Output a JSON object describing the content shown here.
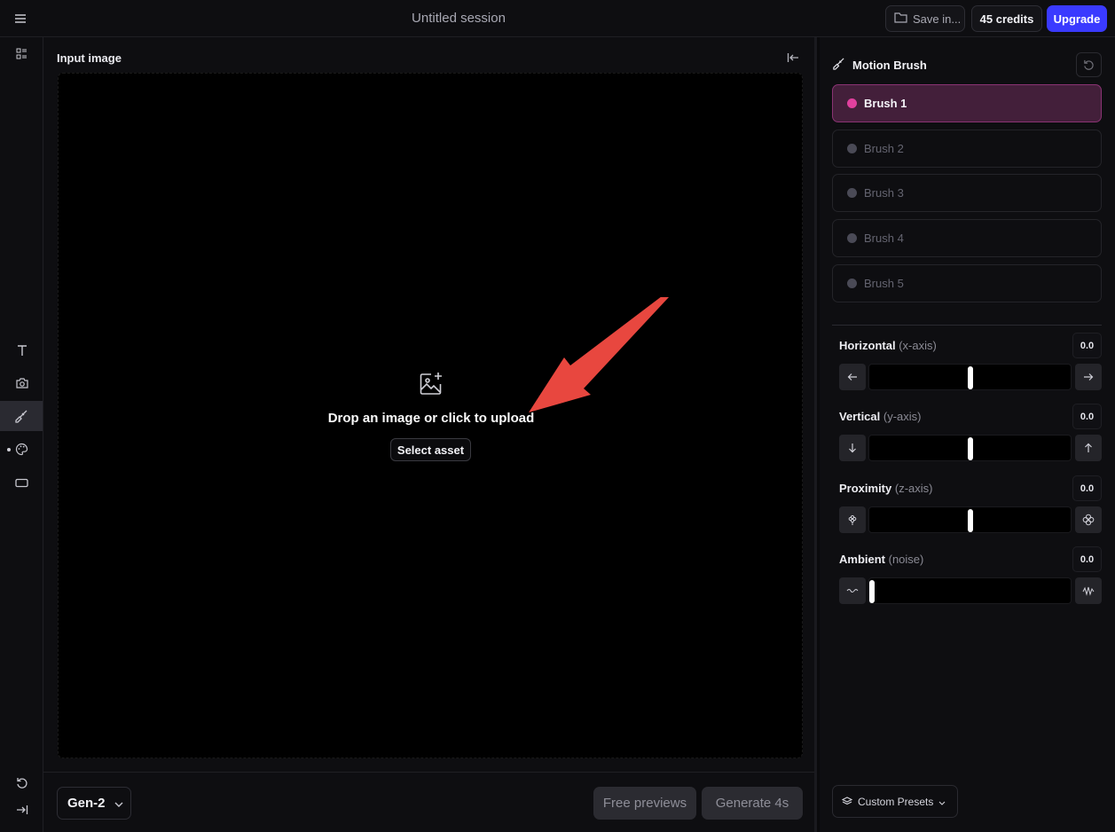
{
  "header": {
    "title": "Untitled session",
    "save_label": "Save in...",
    "credits_label": "45 credits",
    "upgrade_label": "Upgrade"
  },
  "main": {
    "input_label": "Input image",
    "drop_text": "Drop an image or click to upload",
    "select_asset_label": "Select asset",
    "model_label": "Gen-2",
    "free_previews_label": "Free previews",
    "generate_label": "Generate 4s"
  },
  "motion_brush": {
    "title": "Motion Brush",
    "brushes": [
      "Brush 1",
      "Brush 2",
      "Brush 3",
      "Brush 4",
      "Brush 5"
    ],
    "active_brush": "Brush 1",
    "params": [
      {
        "label": "Horizontal",
        "sub": "(x-axis)",
        "value": "0.0"
      },
      {
        "label": "Vertical",
        "sub": "(y-axis)",
        "value": "0.0"
      },
      {
        "label": "Proximity",
        "sub": "(z-axis)",
        "value": "0.0"
      },
      {
        "label": "Ambient",
        "sub": "(noise)",
        "value": "0.0"
      }
    ],
    "presets_label": "Custom Presets"
  },
  "colors": {
    "accent": "#3a3aff",
    "brush_active": "#e0409e",
    "annotation_arrow": "#e8473f"
  },
  "icons": [
    "menu-icon",
    "folder-icon",
    "layout-icon",
    "text-icon",
    "camera-icon",
    "brush-icon",
    "palette-icon",
    "rectangle-icon",
    "undo-icon",
    "expand-icon",
    "collapse-icon",
    "image-add-icon",
    "chevron-down-icon",
    "arrow-left-icon",
    "arrow-right-icon",
    "arrow-down-icon",
    "arrow-up-icon",
    "flower-small-icon",
    "flower-large-icon",
    "wave-low-icon",
    "wave-high-icon",
    "layers-icon"
  ]
}
